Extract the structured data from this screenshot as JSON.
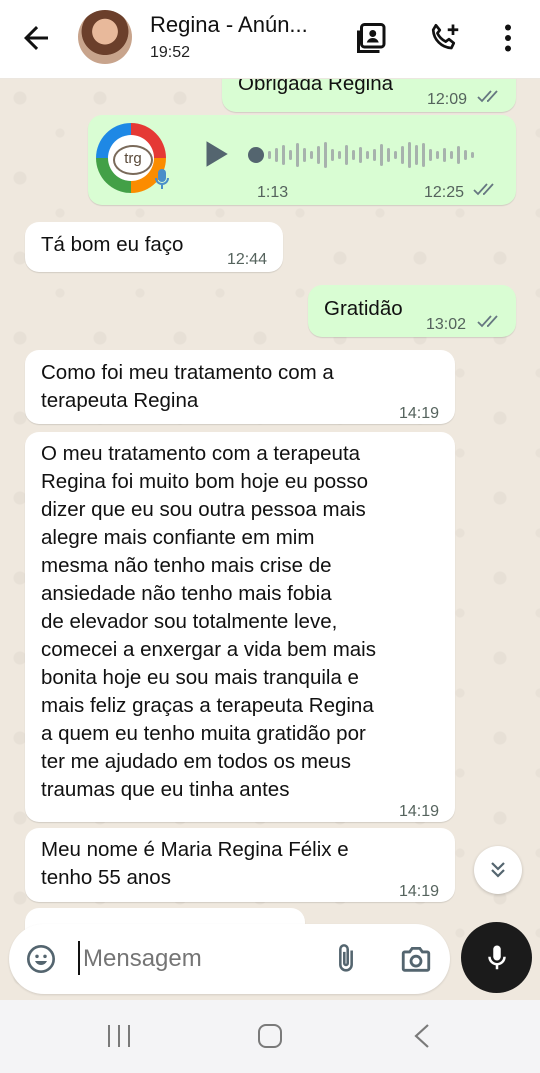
{
  "header": {
    "contact_name": "Regina - Anún...",
    "status": "19:52"
  },
  "messages": [
    {
      "type": "text",
      "dir": "out",
      "text": "Obrigada Regina",
      "time": "12:09"
    },
    {
      "type": "audio",
      "dir": "out",
      "duration": "1:13",
      "time": "12:25",
      "avatar_badge": "trg"
    },
    {
      "type": "text",
      "dir": "in",
      "text": "Tá bom eu faço",
      "time": "12:44"
    },
    {
      "type": "text",
      "dir": "out",
      "text": "Gratidão",
      "time": "13:02"
    },
    {
      "type": "text",
      "dir": "in",
      "text": "Como foi meu tratamento com a\nterapeuta Regina",
      "time": "14:19"
    },
    {
      "type": "text",
      "dir": "in",
      "text": "O meu tratamento com a terapeuta\nRegina foi muito bom hoje eu posso\ndizer que eu sou outra pessoa mais\nalegre mais confiante em mim\nmesma não tenho mais crise de\nansiedade não tenho mais fobia\nde elevador sou totalmente leve,\ncomecei a enxergar a vida bem mais\nbonita hoje eu sou mais tranquila e\nmais feliz graças a terapeuta Regina\na quem eu tenho muita gratidão por\nter me ajudado em todos os meus\ntraumas que eu tinha antes",
      "time": "14:19"
    },
    {
      "type": "text",
      "dir": "in",
      "text": "Meu nome é Maria Regina Félix e\ntenho 55 anos",
      "time": "14:19"
    }
  ],
  "composer": {
    "placeholder": "Mensagem"
  },
  "colors": {
    "outgoing_bubble": "#d9fdd3",
    "incoming_bubble": "#ffffff",
    "mic_button": "#1b1b1b"
  }
}
